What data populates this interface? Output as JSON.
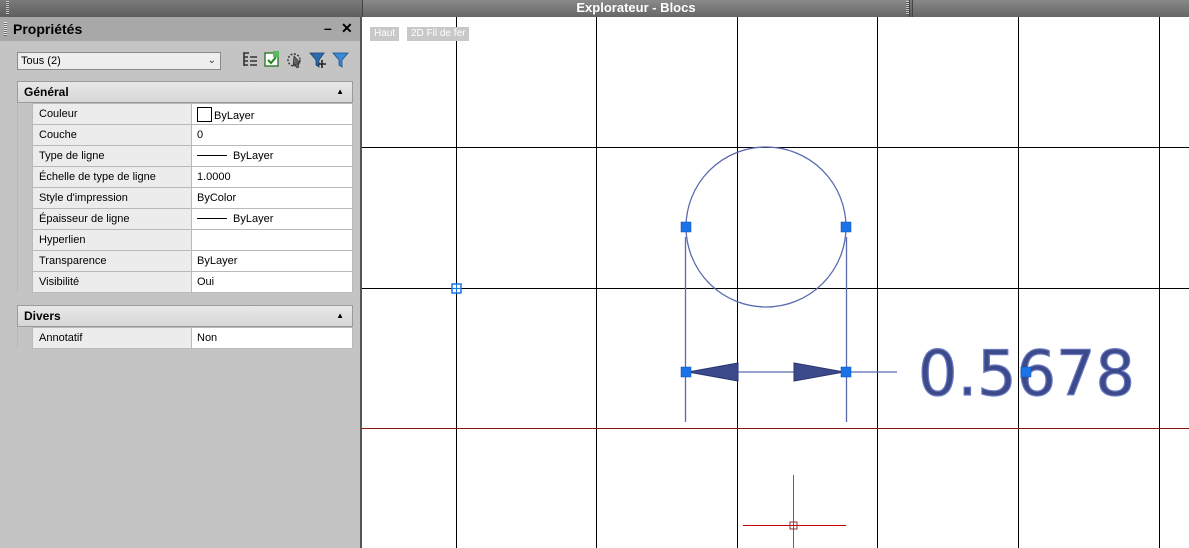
{
  "window": {
    "title": "Explorateur - Blocs"
  },
  "panel": {
    "title": "Propriétés",
    "minimize": "–",
    "close": "✕",
    "selection": {
      "value": "Tous (2)"
    },
    "toolbar_icons": [
      "tree-filter-icon",
      "quick-select-icon",
      "select-objects-icon",
      "toggle-pickadd-icon",
      "filter-icon"
    ]
  },
  "sections": {
    "general": {
      "title": "Général",
      "rows": [
        {
          "name": "Couleur",
          "value": "ByLayer"
        },
        {
          "name": "Couche",
          "value": "0"
        },
        {
          "name": "Type de ligne",
          "value": "ByLayer"
        },
        {
          "name": "Échelle de type de ligne",
          "value": "1.0000"
        },
        {
          "name": "Style d'impression",
          "value": "ByColor"
        },
        {
          "name": "Épaisseur de ligne",
          "value": "ByLayer"
        },
        {
          "name": "Hyperlien",
          "value": ""
        },
        {
          "name": "Transparence",
          "value": "ByLayer"
        },
        {
          "name": "Visibilité",
          "value": "Oui"
        }
      ]
    },
    "misc": {
      "title": "Divers",
      "rows": [
        {
          "name": "Annotatif",
          "value": "Non"
        }
      ]
    }
  },
  "viewport": {
    "view_label": "Haut",
    "style_label": "2D Fil de fer",
    "dimension_text": "0.5678",
    "colors": {
      "grid": "#000000",
      "entity": "#4a5a9a",
      "grip": "#1a73e8",
      "axis_x": "#c80000",
      "axis_y": "#00b000",
      "dimension": "#3c4a8c"
    }
  }
}
